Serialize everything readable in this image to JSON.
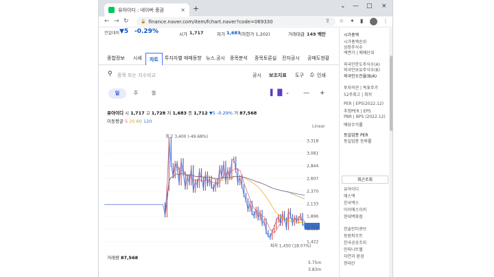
{
  "browser": {
    "tab_title": "유아이디 : 네이버 증권",
    "tab_close": "×",
    "new_tab": "+",
    "url": "finance.naver.com/item/fchart.naver?code=069330",
    "window_controls": [
      "⌄",
      "—",
      "□",
      "×"
    ]
  },
  "sticky": {
    "name": "전일대비",
    "change": "▼5",
    "rate": "-0.29%",
    "open_label": "시가",
    "open_value": "1,717",
    "low_label": "저가",
    "low_value": "1,683",
    "low_limit": "(하한가 1,202)",
    "amount_label": "거래대금",
    "amount_value": "149 백만"
  },
  "page_tabs": [
    "종합정보",
    "시세",
    "차트",
    "투자자별 매매동향",
    "뉴스.공시",
    "종목분석",
    "종목토론실",
    "전자공시",
    "공매도현황"
  ],
  "search": {
    "placeholder": "종목 또는 지수비교",
    "tools": [
      "공시",
      "보조지표",
      "도구",
      "인쇄"
    ]
  },
  "periods": [
    "일",
    "주",
    "월"
  ],
  "info": {
    "name": "유아이디",
    "open_label": "시",
    "open": "1,717",
    "high_label": "고",
    "high": "1,728",
    "low_label": "저",
    "low": "1,683",
    "close_label": "종",
    "close": "1,712",
    "change": "▼5",
    "rate": "-0.29%",
    "vol_label": "거",
    "volume": "87,568",
    "ma_label": "이동평균",
    "ma_values": [
      "5",
      "20",
      "60",
      "120"
    ]
  },
  "chart_data": {
    "type": "line",
    "title": "",
    "scale_label": "Linear",
    "y_ticks": [
      "3,318",
      "3,081",
      "2,844",
      "2,607",
      "2,370",
      "2,133",
      "1,896",
      "1,659",
      "1,422"
    ],
    "ylim": [
      1300,
      3450
    ],
    "current_price": "1,712",
    "high_annotation": "최고 3,400 (-49.68%)",
    "low_annotation": "최저 1,450 (18.07%)",
    "series": [
      {
        "color": "#e15a5a",
        "values": [
          2120,
          2120,
          2120,
          2120,
          2120,
          2120,
          2120,
          2120,
          2120,
          2120,
          2120,
          2120,
          2120,
          2120,
          2120,
          2120,
          2120,
          2120,
          2120,
          2120,
          2120,
          2120,
          2120,
          2120,
          2120,
          2120,
          2120,
          2120,
          2120,
          2120,
          1920,
          2420,
          3340,
          2860,
          2650,
          2900,
          2780,
          2520,
          2950,
          2700,
          2440,
          2650,
          2520,
          2820,
          2380,
          2560,
          2470,
          2760,
          2600,
          2420,
          2700,
          2500,
          2620,
          2460,
          2400,
          2560,
          2480,
          2820,
          2650,
          2900,
          2540,
          2780,
          2620,
          2940,
          2980,
          2760,
          2520,
          2640,
          2460,
          2300,
          2200,
          2020,
          2150,
          1960,
          1900,
          2040,
          1860,
          1980,
          1760,
          1820,
          1600,
          1540,
          1500,
          1620,
          1700,
          1820,
          1900,
          1760,
          1960,
          1840,
          1680,
          2010,
          1900,
          1760,
          1880,
          1800,
          1860,
          1920,
          1760,
          1712
        ]
      }
    ],
    "volume_label": "거래량",
    "volume_value": "87,568",
    "volume_axis": [
      "5.75m",
      "3.83m"
    ]
  },
  "rightpanel": {
    "lines_top": [
      "시가총액",
      "시가총액순위",
      "상장주식수",
      "액면가 | 매매단위",
      "외국인한도주식수(A)",
      "외국인보유주식수(B)",
      "외국인소진율(B/A)",
      "투자의견 | 목표주가",
      "52주최고 | 최저",
      "PER | EPS(2022.12)",
      "추정PER | EPS",
      "PBR | BPS (2022.12)",
      "배당수익률",
      "동일업종 PER",
      "동일업종 등락률"
    ],
    "recent_title": "최근조회",
    "stocks": [
      "유아이디",
      "에스맥",
      "한국맥스",
      "아이에스이커",
      "현대백화점",
      "한솔인티큐브",
      "동원피조트",
      "한국공공조지",
      "인피니트헬",
      "자연과 환경",
      "현대산"
    ]
  }
}
